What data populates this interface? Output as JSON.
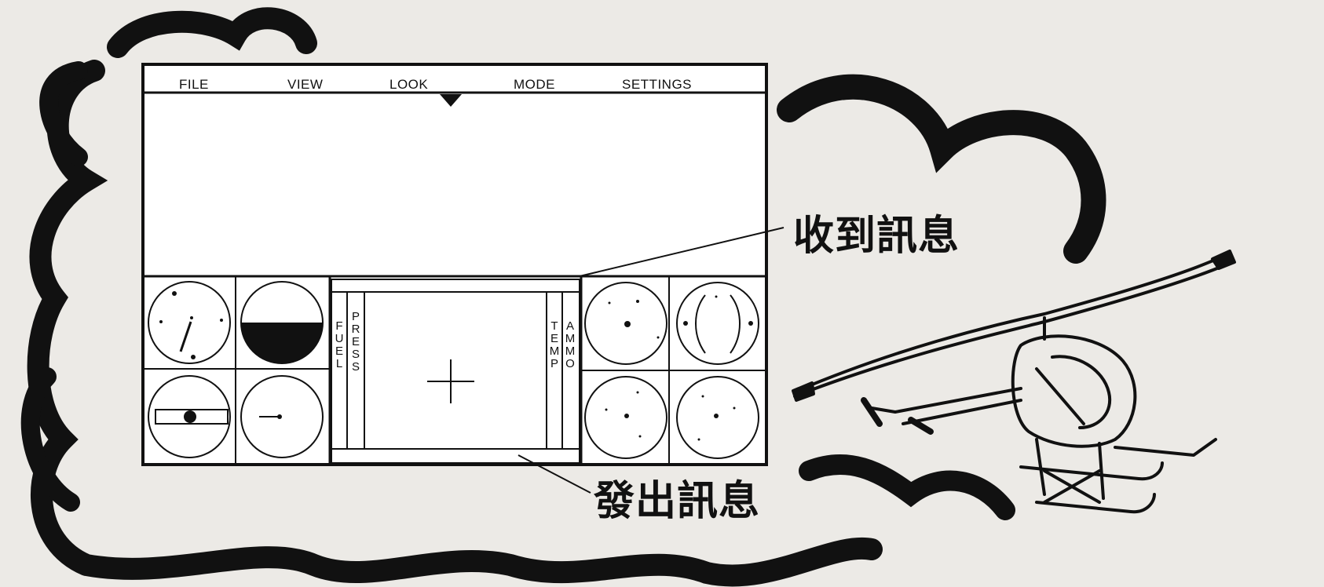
{
  "menu": {
    "items": [
      {
        "id": "file",
        "label": "FILE"
      },
      {
        "id": "view",
        "label": "VIEW"
      },
      {
        "id": "look",
        "label": "LOOK"
      },
      {
        "id": "mode",
        "label": "MODE"
      },
      {
        "id": "settings",
        "label": "SETTINGS"
      }
    ]
  },
  "gauges": {
    "fuel_label": "FUEL",
    "press_label": "PRESS",
    "temp_label": "TEMP",
    "ammo_label": "AMMO"
  },
  "callouts": {
    "received": "收到訊息",
    "sent": "發出訊息"
  },
  "icons": {
    "crosshair": "crosshair-icon",
    "menu_pointer": "triangle-down-icon",
    "helicopter": "helicopter-illustration"
  },
  "colors": {
    "ink": "#111111",
    "paper": "#eceae6",
    "screen": "#ffffff"
  }
}
